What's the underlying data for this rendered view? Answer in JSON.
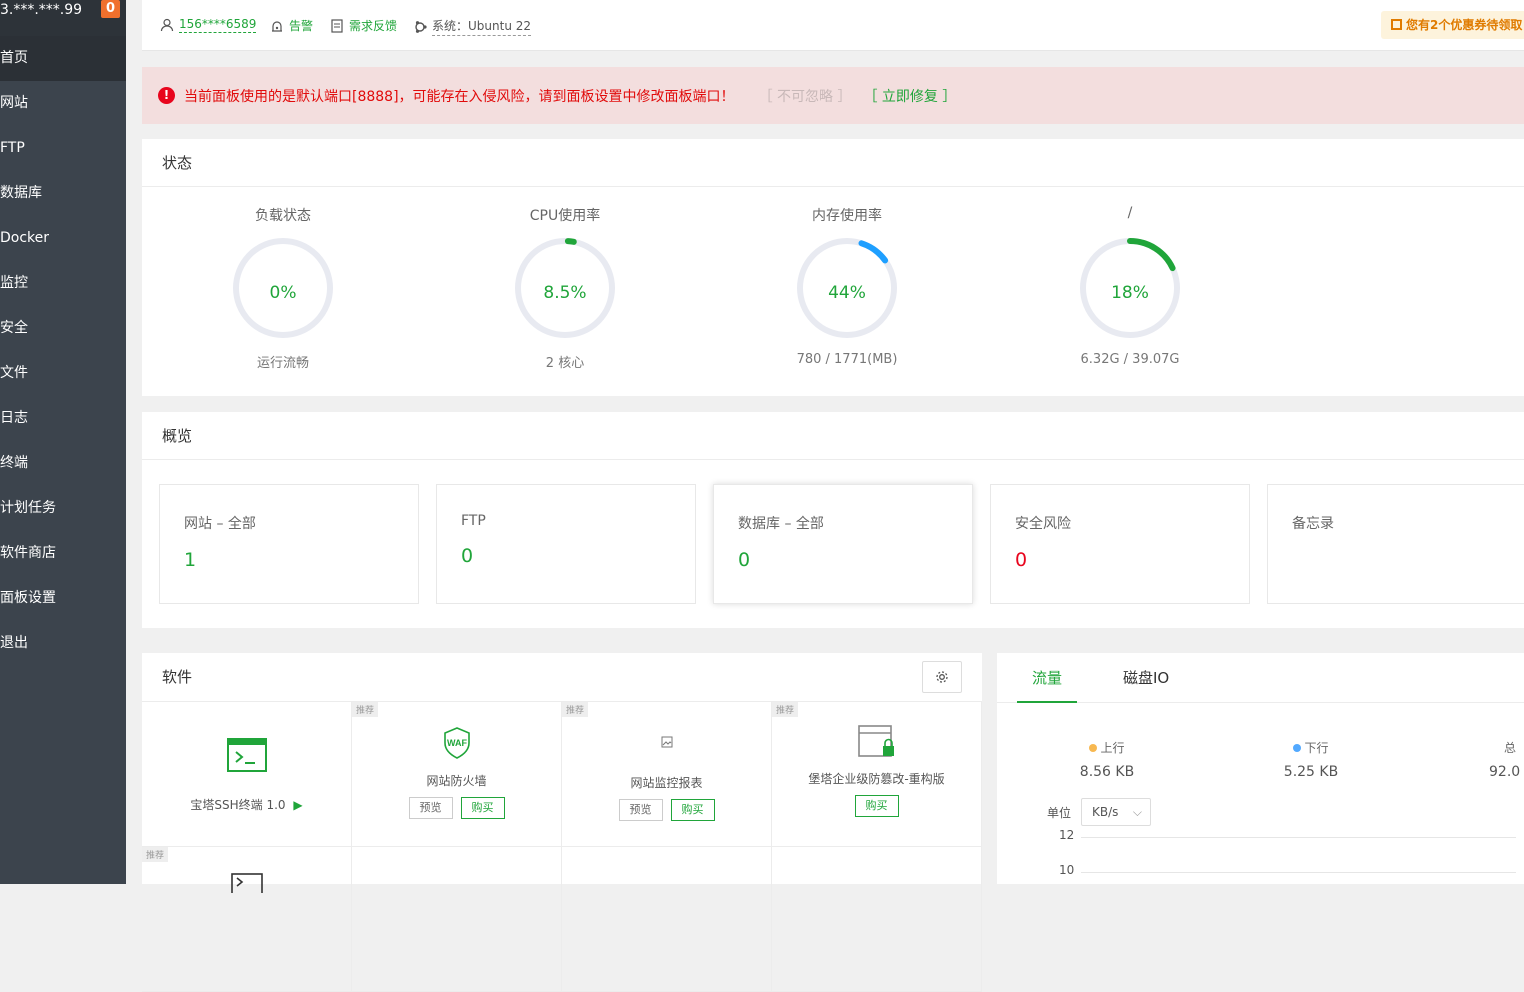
{
  "sidebar": {
    "ip": "3.***.***.99",
    "badge": "0",
    "items": [
      {
        "label": "首页"
      },
      {
        "label": "网站"
      },
      {
        "label": "FTP"
      },
      {
        "label": "数据库"
      },
      {
        "label": "Docker"
      },
      {
        "label": "监控"
      },
      {
        "label": "安全"
      },
      {
        "label": "文件"
      },
      {
        "label": "日志"
      },
      {
        "label": "终端"
      },
      {
        "label": "计划任务"
      },
      {
        "label": "软件商店"
      },
      {
        "label": "面板设置"
      },
      {
        "label": "退出"
      }
    ]
  },
  "header": {
    "user": "156****6589",
    "alarm": "告警",
    "feedback": "需求反馈",
    "system": "系统：Ubuntu 22",
    "coupon": "您有2个优惠券待领取"
  },
  "alert": {
    "message": "当前面板使用的是默认端口[8888]，可能存在入侵风险，请到面板设置中修改面板端口！",
    "ignore": "［ 不可忽略 ］",
    "fix": "［ 立即修复 ］"
  },
  "status": {
    "title": "状态",
    "gauges": [
      {
        "label": "负载状态",
        "value": "0%",
        "sub": "运行流畅",
        "percent": 0,
        "color": "#20a53a"
      },
      {
        "label": "CPU使用率",
        "value": "8.5%",
        "sub": "2 核心",
        "percent": 0,
        "color": "#20a53a"
      },
      {
        "label": "内存使用率",
        "value": "44%",
        "sub": "780 / 1771(MB)",
        "percent": 0,
        "color": "#1e9fff"
      },
      {
        "label": "/",
        "value": "18%",
        "sub": "6.32G / 39.07G",
        "percent": 18,
        "color": "#20a53a"
      }
    ]
  },
  "overview": {
    "title": "概览",
    "cards": [
      {
        "name": "网站 – 全部",
        "num": "1"
      },
      {
        "name": "FTP",
        "num": "0"
      },
      {
        "name": "数据库 – 全部",
        "num": "0"
      },
      {
        "name": "安全风险",
        "num": "0"
      },
      {
        "name": "备忘录",
        "num": ""
      }
    ]
  },
  "software": {
    "title": "软件",
    "tag": "推荐",
    "items": [
      {
        "name": "宝塔SSH终端 1.0"
      },
      {
        "name": "网站防火墙",
        "preview": "预览",
        "buy": "购买"
      },
      {
        "name": "网站监控报表",
        "preview": "预览",
        "buy": "购买"
      },
      {
        "name": "堡塔企业级防篡改-重构版",
        "buy": "购买"
      }
    ]
  },
  "traffic": {
    "tabs": [
      "流量",
      "磁盘IO"
    ],
    "up_label": "上行",
    "up_value": "8.56 KB",
    "down_label": "下行",
    "down_value": "5.25 KB",
    "total_label": "总",
    "total_value": "92.0",
    "unit_label": "单位",
    "unit_value": "KB/s",
    "yticks": [
      "12",
      "10"
    ],
    "colors": {
      "up": "#f7b851",
      "down": "#52a9ff"
    }
  }
}
